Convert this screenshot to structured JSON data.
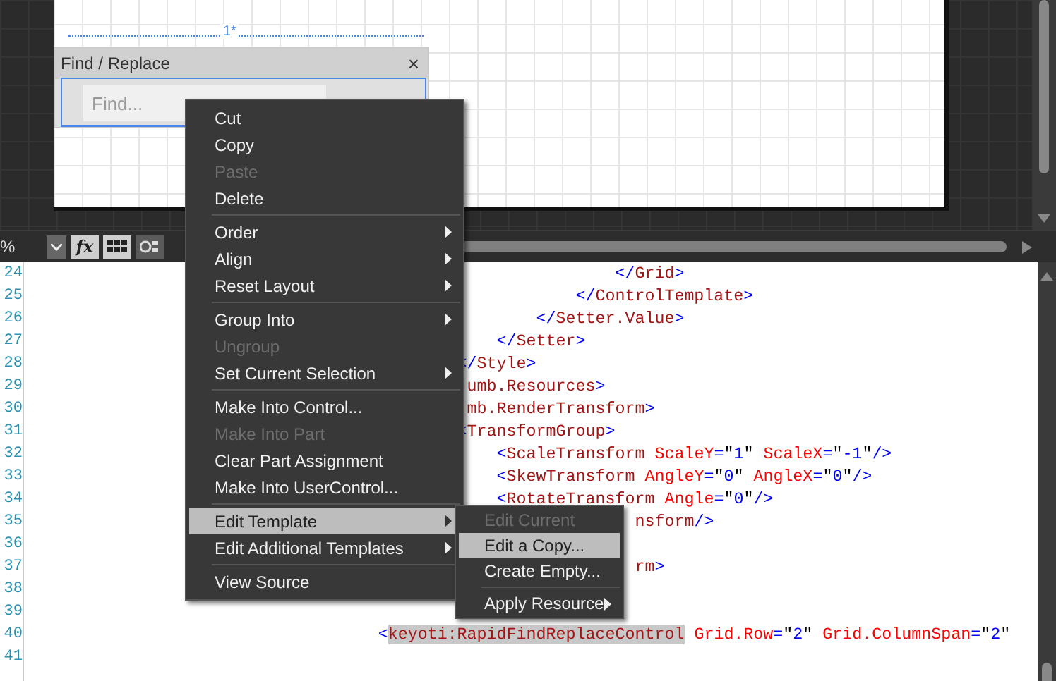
{
  "designer": {
    "control": {
      "title": "Find / Replace",
      "close": "×",
      "find_placeholder": "Find..."
    },
    "column_label": "1*"
  },
  "toolbar": {
    "zoom_text": "%",
    "fx": "fx"
  },
  "editor": {
    "lines": [
      {
        "number": "24",
        "parts": [
          {
            "text": "                                                        </Grid>",
            "selected": false
          }
        ]
      },
      {
        "number": "25",
        "parts": [
          {
            "text": "                                                    </ControlTemplate>",
            "selected": false
          }
        ]
      },
      {
        "number": "26",
        "parts": [
          {
            "text": "                                                </Setter.Value>",
            "selected": false
          }
        ]
      },
      {
        "number": "27",
        "parts": [
          {
            "text": "                                            </Setter>",
            "selected": false
          }
        ]
      },
      {
        "number": "28",
        "parts": [
          {
            "text": "                                        </Style>",
            "selected": false
          }
        ]
      },
      {
        "number": "29",
        "parts": [
          {
            "text": "                                         umb.Resources>",
            "selected": false
          }
        ]
      },
      {
        "number": "30",
        "parts": [
          {
            "text": "                                         mb.RenderTransform>",
            "selected": false
          }
        ]
      },
      {
        "number": "31",
        "parts": [
          {
            "text": "                                        <TransformGroup>",
            "selected": false
          }
        ]
      },
      {
        "number": "32",
        "parts": [
          {
            "text": "                                            <ScaleTransform ScaleY=\"1\" ScaleX=\"-1\"/>",
            "selected": false
          }
        ]
      },
      {
        "number": "33",
        "parts": [
          {
            "text": "                                            <SkewTransform AngleY=\"0\" AngleX=\"0\"/>",
            "selected": false
          }
        ]
      },
      {
        "number": "34",
        "parts": [
          {
            "text": "                                            <RotateTransform Angle=\"0\"/>",
            "selected": false
          }
        ]
      },
      {
        "number": "35",
        "parts": [
          {
            "text": "                                                          nsform/>",
            "selected": false
          }
        ]
      },
      {
        "number": "36"
      },
      {
        "number": "37",
        "parts": [
          {
            "text": "                                                          rm>",
            "selected": false
          }
        ]
      },
      {
        "number": "38"
      },
      {
        "number": "39"
      },
      {
        "number": "40",
        "parts": [
          {
            "text": "                                <",
            "selected": false
          },
          {
            "text": "keyoti:RapidFindReplaceControl",
            "selected": true
          },
          {
            "text": " Grid.Row=\"2\" Grid.ColumnSpan=\"2\"",
            "selected": false
          }
        ]
      },
      {
        "number": "41"
      }
    ]
  },
  "context_menu": {
    "items": [
      {
        "kind": "item",
        "label": "Cut",
        "disabled": false,
        "submenu": false,
        "selected": false
      },
      {
        "kind": "item",
        "label": "Copy",
        "disabled": false,
        "submenu": false,
        "selected": false
      },
      {
        "kind": "item",
        "label": "Paste",
        "disabled": true,
        "submenu": false,
        "selected": false
      },
      {
        "kind": "item",
        "label": "Delete",
        "disabled": false,
        "submenu": false,
        "selected": false
      },
      {
        "kind": "separator"
      },
      {
        "kind": "item",
        "label": "Order",
        "disabled": false,
        "submenu": true,
        "selected": false
      },
      {
        "kind": "item",
        "label": "Align",
        "disabled": false,
        "submenu": true,
        "selected": false
      },
      {
        "kind": "item",
        "label": "Reset Layout",
        "disabled": false,
        "submenu": true,
        "selected": false
      },
      {
        "kind": "separator"
      },
      {
        "kind": "item",
        "label": "Group Into",
        "disabled": false,
        "submenu": true,
        "selected": false
      },
      {
        "kind": "item",
        "label": "Ungroup",
        "disabled": true,
        "submenu": false,
        "selected": false
      },
      {
        "kind": "item",
        "label": "Set Current Selection",
        "disabled": false,
        "submenu": true,
        "selected": false
      },
      {
        "kind": "separator"
      },
      {
        "kind": "item",
        "label": "Make Into Control...",
        "disabled": false,
        "submenu": false,
        "selected": false
      },
      {
        "kind": "item",
        "label": "Make Into Part",
        "disabled": true,
        "submenu": false,
        "selected": false
      },
      {
        "kind": "item",
        "label": "Clear Part Assignment",
        "disabled": false,
        "submenu": false,
        "selected": false
      },
      {
        "kind": "item",
        "label": "Make Into UserControl...",
        "disabled": false,
        "submenu": false,
        "selected": false
      },
      {
        "kind": "separator"
      },
      {
        "kind": "item",
        "label": "Edit Template",
        "disabled": false,
        "submenu": true,
        "selected": true
      },
      {
        "kind": "item",
        "label": "Edit Additional Templates",
        "disabled": false,
        "submenu": true,
        "selected": false
      },
      {
        "kind": "separator"
      },
      {
        "kind": "item",
        "label": "View Source",
        "disabled": false,
        "submenu": false,
        "selected": false
      }
    ]
  },
  "submenu": {
    "items": [
      {
        "kind": "item",
        "label": "Edit Current",
        "disabled": true,
        "submenu": false,
        "selected": false
      },
      {
        "kind": "item",
        "label": "Edit a Copy...",
        "disabled": false,
        "submenu": false,
        "selected": true
      },
      {
        "kind": "item",
        "label": "Create Empty...",
        "disabled": false,
        "submenu": false,
        "selected": false
      },
      {
        "kind": "separator"
      },
      {
        "kind": "item",
        "label": "Apply Resource",
        "disabled": false,
        "submenu": true,
        "selected": false
      }
    ]
  }
}
